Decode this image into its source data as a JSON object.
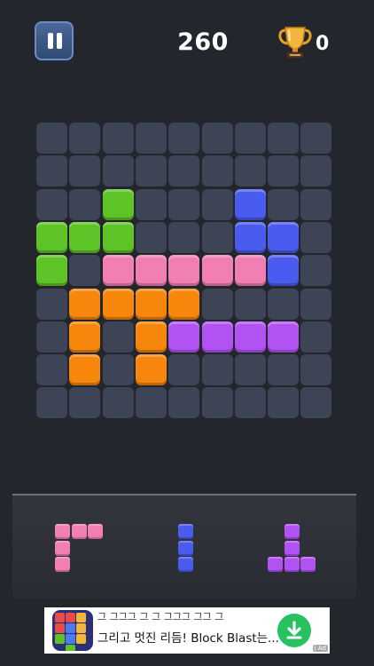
{
  "header": {
    "score": "260",
    "best": "0",
    "pause_icon": "pause-icon",
    "trophy_icon": "trophy-icon"
  },
  "colors": {
    "empty": "#3d4455",
    "green": "#5ec326",
    "blue": "#4a5cf0",
    "pink": "#f27fb4",
    "orange": "#f7860c",
    "purple": "#b352f2"
  },
  "board": {
    "rows": 9,
    "cols": 9,
    "grid": [
      [
        ".",
        ".",
        ".",
        ".",
        ".",
        ".",
        ".",
        ".",
        "."
      ],
      [
        ".",
        ".",
        ".",
        ".",
        ".",
        ".",
        ".",
        ".",
        "."
      ],
      [
        ".",
        ".",
        "G",
        ".",
        ".",
        ".",
        "B",
        ".",
        "."
      ],
      [
        "G",
        "G",
        "G",
        ".",
        ".",
        ".",
        "B",
        "B",
        "."
      ],
      [
        "G",
        ".",
        "P",
        "P",
        "P",
        "P",
        "P",
        "B",
        "."
      ],
      [
        ".",
        "O",
        "O",
        "O",
        "O",
        ".",
        ".",
        ".",
        "."
      ],
      [
        ".",
        "O",
        ".",
        "O",
        "V",
        "V",
        "V",
        "V",
        "."
      ],
      [
        ".",
        "O",
        ".",
        "O",
        ".",
        ".",
        ".",
        ".",
        "."
      ],
      [
        ".",
        ".",
        ".",
        ".",
        ".",
        ".",
        ".",
        ".",
        "."
      ]
    ]
  },
  "tray": {
    "pieces": [
      {
        "color": "P",
        "cells": [
          [
            0,
            0
          ],
          [
            0,
            1
          ],
          [
            0,
            2
          ],
          [
            1,
            0
          ],
          [
            2,
            0
          ]
        ]
      },
      {
        "color": "B",
        "cells": [
          [
            0,
            0
          ],
          [
            1,
            0
          ],
          [
            2,
            0
          ]
        ]
      },
      {
        "color": "V",
        "cells": [
          [
            0,
            1
          ],
          [
            1,
            1
          ],
          [
            2,
            0
          ],
          [
            2,
            1
          ],
          [
            2,
            2
          ]
        ]
      }
    ]
  },
  "ad": {
    "line1": "그 그그그 그 그 그그그 그그 그",
    "line2": "그리고 멋진 리듬! Block Blast는...",
    "badge": "i Ad",
    "download_icon": "download-icon",
    "logo_icon": "app-logo-icon"
  }
}
